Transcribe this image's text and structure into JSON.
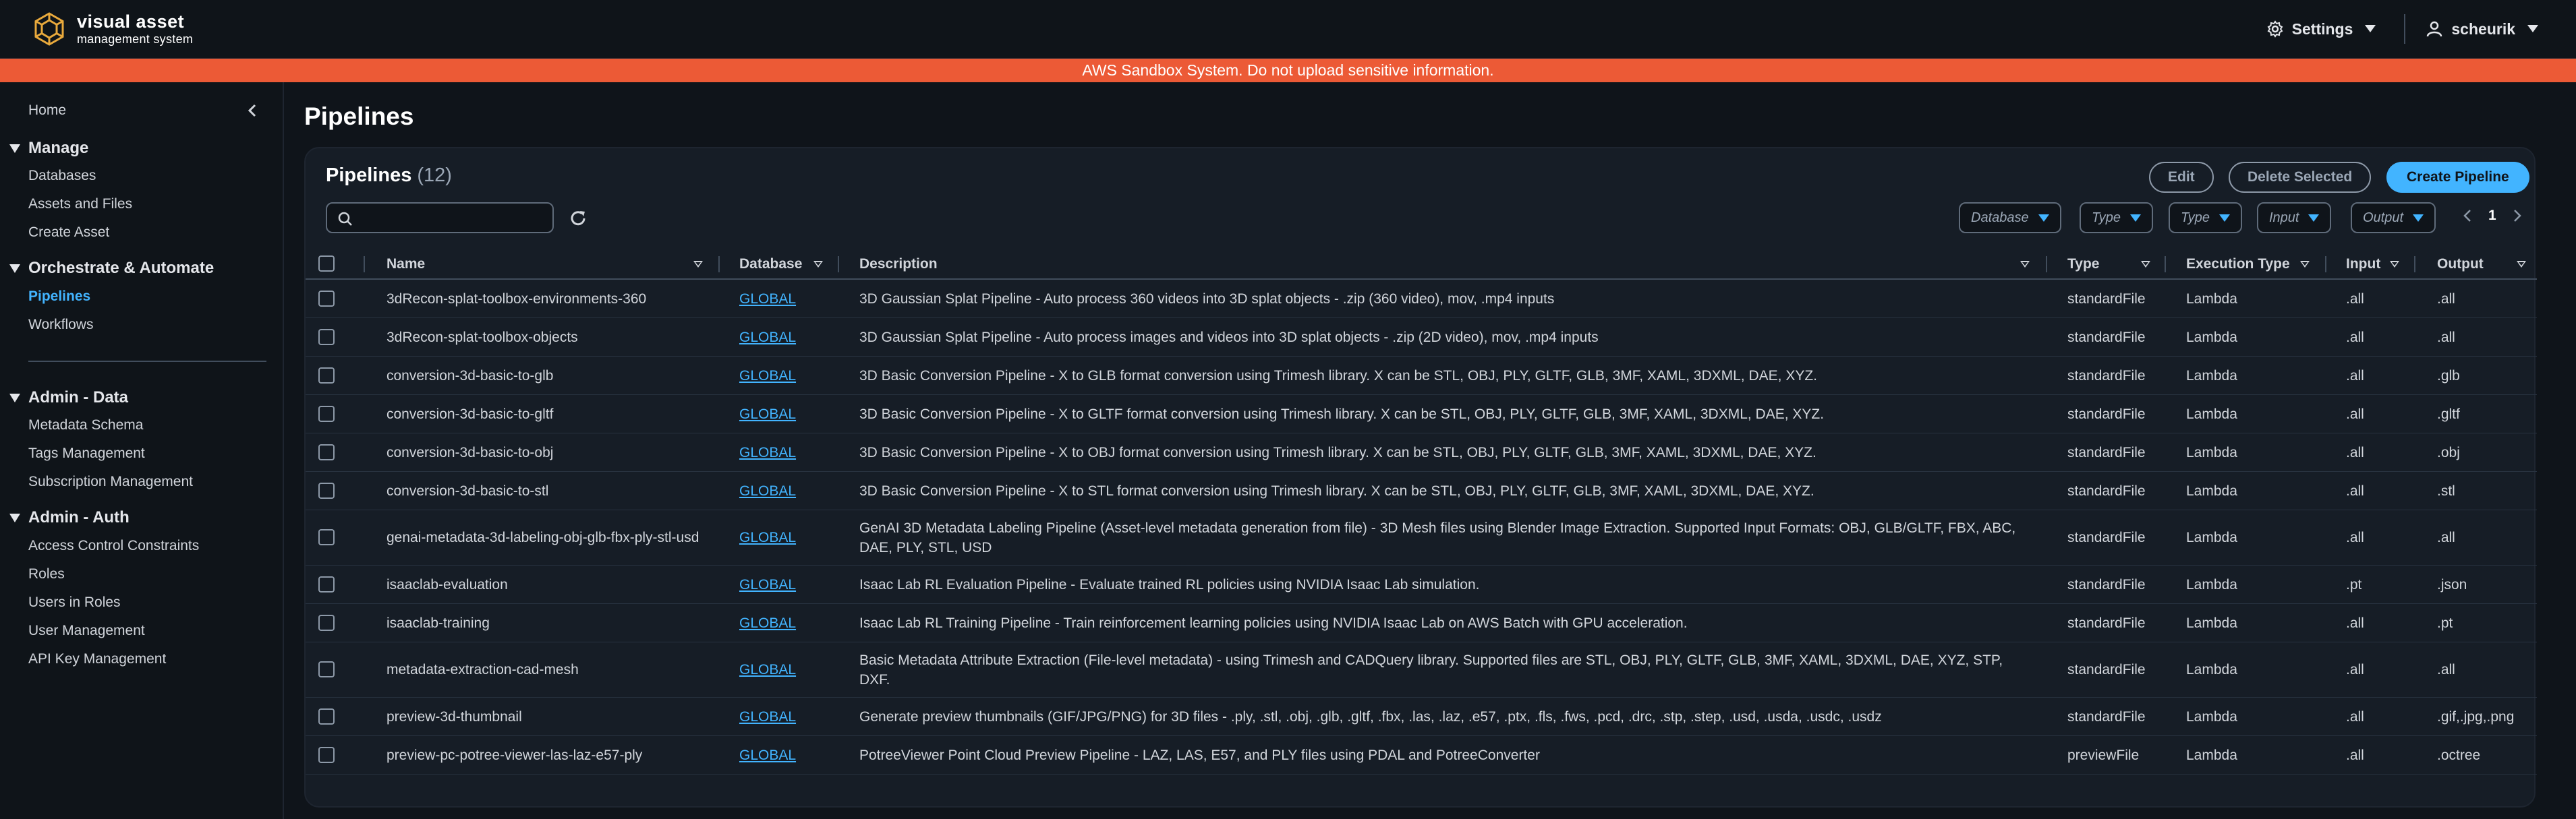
{
  "header": {
    "logo_title": "visual asset",
    "logo_subtitle": "management system",
    "settings_label": "Settings",
    "user_label": "scheurik"
  },
  "banner": {
    "text": "AWS Sandbox System. Do not upload sensitive information."
  },
  "sidebar": {
    "home": "Home",
    "sections": [
      {
        "title": "Manage",
        "items": [
          "Databases",
          "Assets and Files",
          "Create Asset"
        ]
      },
      {
        "title": "Orchestrate & Automate",
        "items": [
          "Pipelines",
          "Workflows"
        ]
      },
      {
        "title": "Admin - Data",
        "items": [
          "Metadata Schema",
          "Tags Management",
          "Subscription Management"
        ]
      },
      {
        "title": "Admin - Auth",
        "items": [
          "Access Control Constraints",
          "Roles",
          "Users in Roles",
          "User Management",
          "API Key Management"
        ]
      }
    ],
    "active_item": "Pipelines"
  },
  "page": {
    "title": "Pipelines"
  },
  "container": {
    "title": "Pipelines",
    "count": "(12)",
    "edit_label": "Edit",
    "delete_label": "Delete Selected",
    "create_label": "Create Pipeline",
    "search_placeholder": "",
    "filters": [
      "Database",
      "Type",
      "Type",
      "Input",
      "Output"
    ],
    "page_number": "1"
  },
  "table": {
    "columns": [
      "Name",
      "Database",
      "Description",
      "Type",
      "Execution Type",
      "Input",
      "Output"
    ],
    "rows": [
      {
        "name": "3dRecon-splat-toolbox-environments-360",
        "database": "GLOBAL",
        "description": "3D Gaussian Splat Pipeline - Auto process 360 videos into 3D splat objects - .zip (360 video), mov, .mp4 inputs",
        "type": "standardFile",
        "exec": "Lambda",
        "input": ".all",
        "output": ".all"
      },
      {
        "name": "3dRecon-splat-toolbox-objects",
        "database": "GLOBAL",
        "description": "3D Gaussian Splat Pipeline - Auto process images and videos into 3D splat objects - .zip (2D video), mov, .mp4 inputs",
        "type": "standardFile",
        "exec": "Lambda",
        "input": ".all",
        "output": ".all"
      },
      {
        "name": "conversion-3d-basic-to-glb",
        "database": "GLOBAL",
        "description": "3D Basic Conversion Pipeline - X to GLB format conversion using Trimesh library. X can be STL, OBJ, PLY, GLTF, GLB, 3MF, XAML, 3DXML, DAE, XYZ.",
        "type": "standardFile",
        "exec": "Lambda",
        "input": ".all",
        "output": ".glb"
      },
      {
        "name": "conversion-3d-basic-to-gltf",
        "database": "GLOBAL",
        "description": "3D Basic Conversion Pipeline - X to GLTF format conversion using Trimesh library. X can be STL, OBJ, PLY, GLTF, GLB, 3MF, XAML, 3DXML, DAE, XYZ.",
        "type": "standardFile",
        "exec": "Lambda",
        "input": ".all",
        "output": ".gltf"
      },
      {
        "name": "conversion-3d-basic-to-obj",
        "database": "GLOBAL",
        "description": "3D Basic Conversion Pipeline - X to OBJ format conversion using Trimesh library. X can be STL, OBJ, PLY, GLTF, GLB, 3MF, XAML, 3DXML, DAE, XYZ.",
        "type": "standardFile",
        "exec": "Lambda",
        "input": ".all",
        "output": ".obj"
      },
      {
        "name": "conversion-3d-basic-to-stl",
        "database": "GLOBAL",
        "description": "3D Basic Conversion Pipeline - X to STL format conversion using Trimesh library. X can be STL, OBJ, PLY, GLTF, GLB, 3MF, XAML, 3DXML, DAE, XYZ.",
        "type": "standardFile",
        "exec": "Lambda",
        "input": ".all",
        "output": ".stl"
      },
      {
        "name": "genai-metadata-3d-labeling-obj-glb-fbx-ply-stl-usd",
        "database": "GLOBAL",
        "description": "GenAI 3D Metadata Labeling Pipeline (Asset-level metadata generation from file) - 3D Mesh files using Blender Image Extraction. Supported Input Formats: OBJ, GLB/GLTF, FBX, ABC, DAE, PLY, STL, USD",
        "type": "standardFile",
        "exec": "Lambda",
        "input": ".all",
        "output": ".all"
      },
      {
        "name": "isaaclab-evaluation",
        "database": "GLOBAL",
        "description": "Isaac Lab RL Evaluation Pipeline - Evaluate trained RL policies using NVIDIA Isaac Lab simulation.",
        "type": "standardFile",
        "exec": "Lambda",
        "input": ".pt",
        "output": ".json"
      },
      {
        "name": "isaaclab-training",
        "database": "GLOBAL",
        "description": "Isaac Lab RL Training Pipeline - Train reinforcement learning policies using NVIDIA Isaac Lab on AWS Batch with GPU acceleration.",
        "type": "standardFile",
        "exec": "Lambda",
        "input": ".all",
        "output": ".pt"
      },
      {
        "name": "metadata-extraction-cad-mesh",
        "database": "GLOBAL",
        "description": "Basic Metadata Attribute Extraction (File-level metadata) - using Trimesh and CADQuery library. Supported files are STL, OBJ, PLY, GLTF, GLB, 3MF, XAML, 3DXML, DAE, XYZ, STP, DXF.",
        "type": "standardFile",
        "exec": "Lambda",
        "input": ".all",
        "output": ".all"
      },
      {
        "name": "preview-3d-thumbnail",
        "database": "GLOBAL",
        "description": "Generate preview thumbnails (GIF/JPG/PNG) for 3D files - .ply, .stl, .obj, .glb, .gltf, .fbx, .las, .laz, .e57, .ptx, .fls, .fws, .pcd, .drc, .stp, .step, .usd, .usda, .usdc, .usdz",
        "type": "standardFile",
        "exec": "Lambda",
        "input": ".all",
        "output": ".gif,.jpg,.png"
      },
      {
        "name": "preview-pc-potree-viewer-las-laz-e57-ply",
        "database": "GLOBAL",
        "description": "PotreeViewer Point Cloud Preview Pipeline - LAZ, LAS, E57, and PLY files using PDAL and PotreeConverter",
        "type": "previewFile",
        "exec": "Lambda",
        "input": ".all",
        "output": ".octree"
      }
    ]
  }
}
